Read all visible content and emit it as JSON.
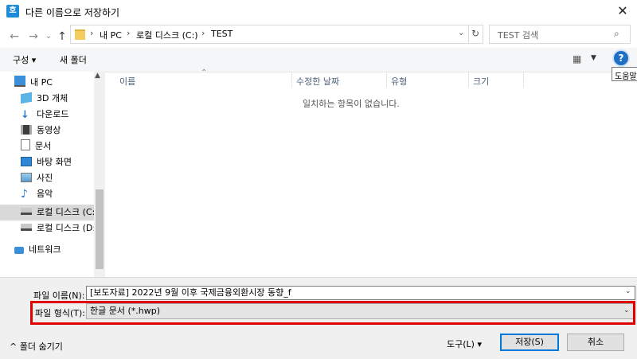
{
  "window": {
    "title": "다른 이름으로 저장하기",
    "app_icon_glyph": "호",
    "close_glyph": "✕"
  },
  "nav": {
    "back_glyph": "←",
    "forward_glyph": "→",
    "recent_glyph": "⌄",
    "up_glyph": "↑",
    "breadcrumb": [
      "내 PC",
      "로컬 디스크 (C:)",
      "TEST"
    ],
    "breadcrumb_sep": "›",
    "dropdown_glyph": "⌄",
    "refresh_glyph": "↻",
    "search_placeholder": "TEST 검색",
    "search_icon_glyph": "⌕"
  },
  "toolbar": {
    "organize_label": "구성 ▾",
    "new_folder_label": "새 폴더",
    "view_glyph": "▦",
    "view_dd_glyph": "▼",
    "help_glyph": "?",
    "help_tooltip": "도움말"
  },
  "sidebar": {
    "items": [
      {
        "label": "내 PC",
        "icon": "pc-icon"
      },
      {
        "label": "3D 개체",
        "icon": "3d-objects-icon"
      },
      {
        "label": "다운로드",
        "icon": "download-icon"
      },
      {
        "label": "동영상",
        "icon": "video-icon"
      },
      {
        "label": "문서",
        "icon": "document-icon"
      },
      {
        "label": "바탕 화면",
        "icon": "desktop-icon"
      },
      {
        "label": "사진",
        "icon": "pictures-icon"
      },
      {
        "label": "음악",
        "icon": "music-icon"
      },
      {
        "label": "로컬 디스크 (C:)",
        "icon": "drive-icon",
        "selected": true
      },
      {
        "label": "로컬 디스크 (D:)",
        "icon": "drive-icon"
      },
      {
        "label": "네트워크",
        "icon": "network-icon"
      }
    ],
    "scroll_up_glyph": "▲"
  },
  "filelist": {
    "columns": [
      "이름",
      "수정한 날짜",
      "유형",
      "크기"
    ],
    "sort_glyph": "⌃",
    "empty_message": "일치하는 항목이 없습니다."
  },
  "form": {
    "filename_label": "파일 이름(N):",
    "filename_value": "[보도자료] 2022년 9월 이후 국제금융외환시장 동향_f",
    "filetype_label": "파일 형식(T):",
    "filetype_value": "한글 문서 (*.hwp)",
    "dd_glyph": "⌄"
  },
  "footer": {
    "hide_folders_label": "^  폴더 숨기기",
    "tools_label": "도구(L)   ▾",
    "save_label": "저장(S)",
    "cancel_label": "취소"
  },
  "colors": {
    "accent": "#0078d7",
    "highlight_box": "#e00000"
  }
}
